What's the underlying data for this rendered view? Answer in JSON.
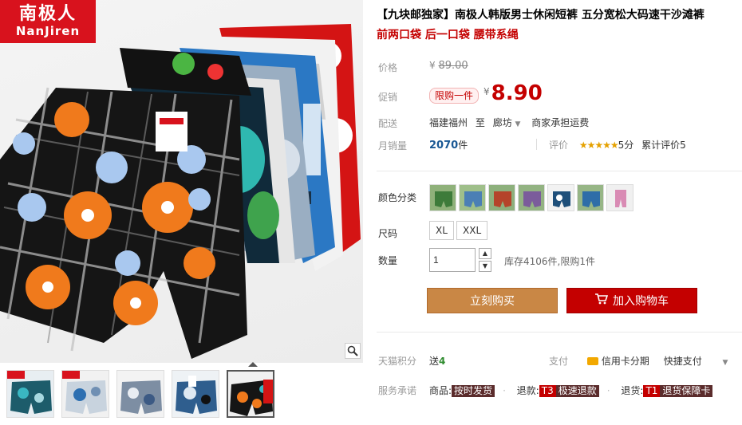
{
  "brand": {
    "logo_cn": "南极人",
    "logo_en": "NanJiren"
  },
  "product": {
    "title": "【九块邮独家】南极人韩版男士休闲短裤 五分宽松大码速干沙滩裤",
    "subtitle": "前两口袋 后一口袋 腰带系绳"
  },
  "price": {
    "label": "价格",
    "currency": "¥",
    "original": "89.00",
    "promo_label": "促销",
    "promo_badge": "限购一件",
    "promo": "8.90"
  },
  "shipping": {
    "label": "配送",
    "from": "福建福州",
    "to_word": "至",
    "dest": "廊坊",
    "fee": "商家承担运费"
  },
  "sales": {
    "label": "月销量",
    "count": "2070",
    "unit": "件"
  },
  "rating": {
    "label": "评价",
    "stars": "★★★★★",
    "score": "5分",
    "total_label": "累计评价",
    "total": "5"
  },
  "color": {
    "label": "颜色分类"
  },
  "size": {
    "label": "尺码",
    "options": [
      "XL",
      "XXL"
    ]
  },
  "quantity": {
    "label": "数量",
    "value": "1",
    "stock": "库存4106件,限购1件"
  },
  "buttons": {
    "buy_now": "立刻购买",
    "add_cart": "加入购物车"
  },
  "points": {
    "label": "天猫积分",
    "text": "送",
    "value": "4"
  },
  "payment": {
    "label": "支付",
    "credit": "信用卡分期",
    "quick": "快捷支付"
  },
  "promise": {
    "label": "服务承诺",
    "goods_label": "商品:",
    "goods_tag": "按时发货",
    "refund_label": "退款:",
    "refund_tag_code": "T3",
    "refund_tag": "极速退款",
    "return_label": "退货:",
    "return_tag_code": "T1",
    "return_tag": "退货保障卡"
  },
  "icons": {
    "zoom": "magnifier-icon",
    "cart": "cart-icon",
    "card": "credit-card-icon"
  },
  "colors": {
    "accent_red": "#c40000",
    "buy_now": "#c98745",
    "logo_bg": "#d8121d"
  }
}
